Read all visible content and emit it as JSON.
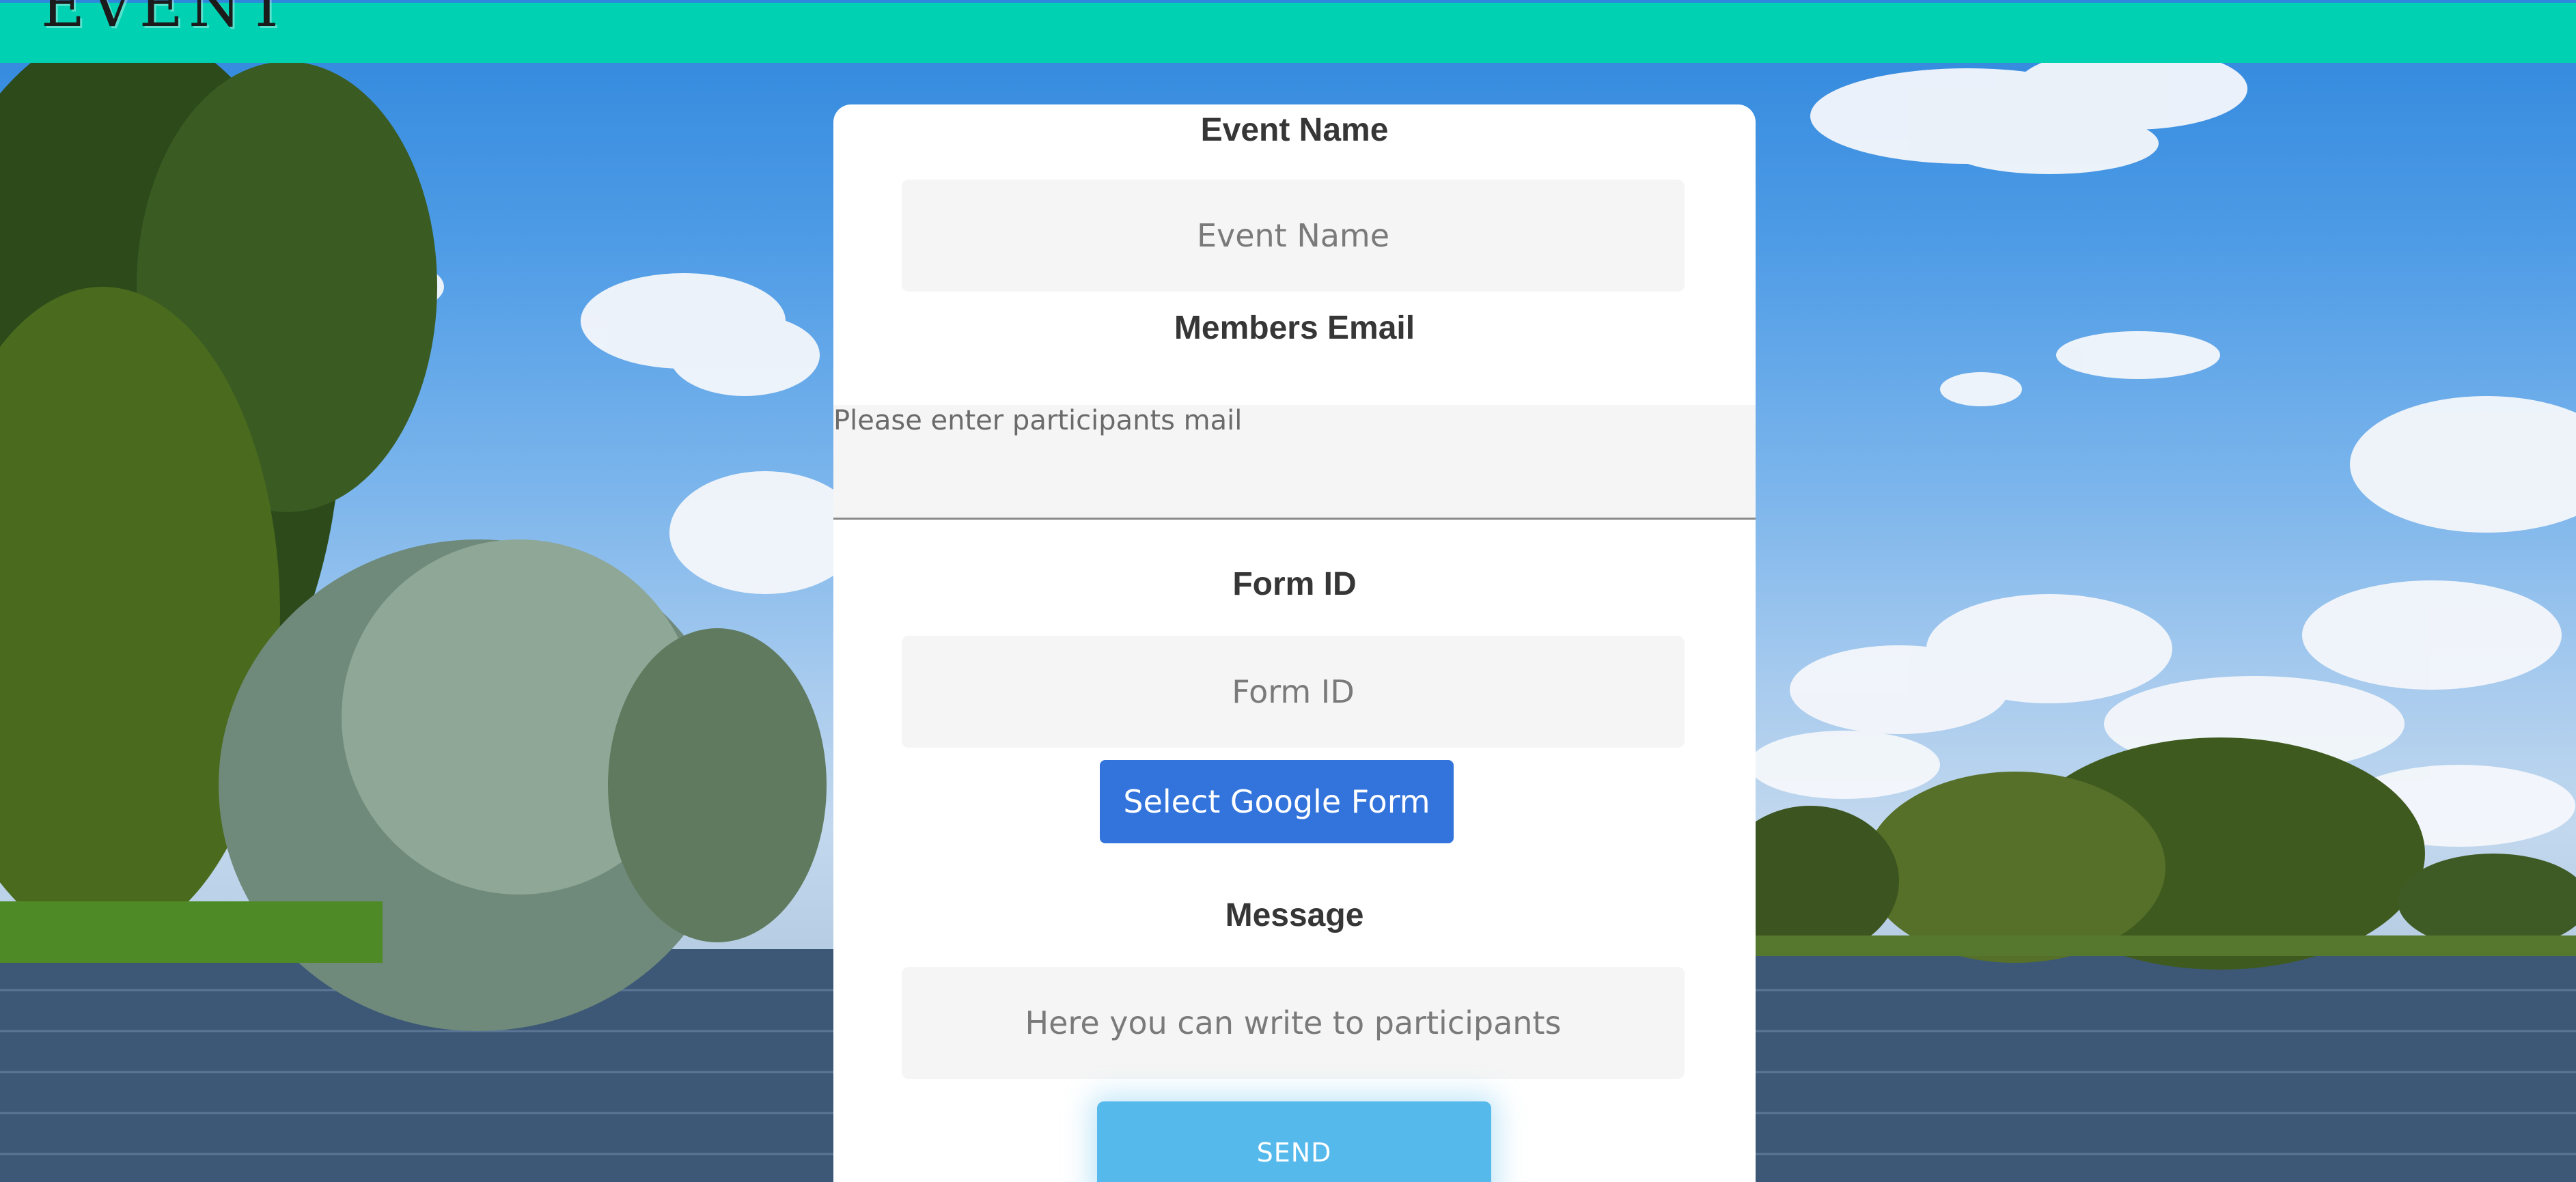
{
  "header": {
    "brand": "EVENT"
  },
  "form": {
    "event_name_label": "Event Name",
    "event_name_placeholder": "Event Name",
    "members_email_label": "Members Email",
    "members_email_placeholder": "Please enter participants mail",
    "form_id_label": "Form ID",
    "form_id_placeholder": "Form ID",
    "select_form_button": "Select Google Form",
    "message_label": "Message",
    "message_placeholder": "Here you can write to participants",
    "send_button": "SEND"
  },
  "colors": {
    "topbar": "#00d1b2",
    "primary_button": "#3273dc",
    "send_button": "#56b9ec",
    "field_background": "#f5f5f5"
  }
}
